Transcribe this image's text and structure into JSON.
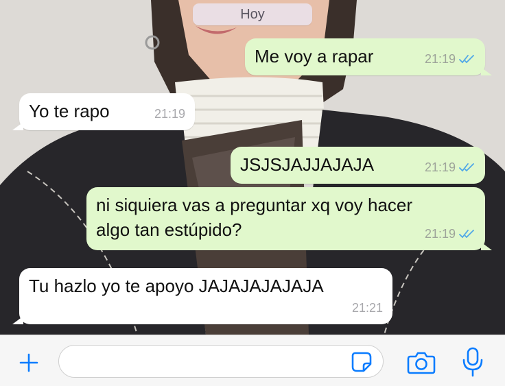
{
  "chat": {
    "day_separator": "Hoy",
    "messages": [
      {
        "direction": "outgoing",
        "text_lines": [
          "Me voy a rapar"
        ],
        "time": "21:19",
        "status": "read"
      },
      {
        "direction": "incoming",
        "text_lines": [
          "Yo te rapo"
        ],
        "time": "21:19"
      },
      {
        "direction": "outgoing",
        "text_lines": [
          "JSJSJAJJAJAJA"
        ],
        "time": "21:19",
        "status": "read"
      },
      {
        "direction": "outgoing",
        "text_lines": [
          "ni siquiera vas a preguntar xq voy hacer",
          "algo tan estúpido?"
        ],
        "time": "21:19",
        "status": "read"
      },
      {
        "direction": "incoming",
        "text_lines": [
          "Tu hazlo yo te apoyo JAJAJAJAJAJA"
        ],
        "time": "21:21"
      }
    ]
  },
  "composer": {
    "placeholder": "",
    "value": "",
    "icons": [
      "plus-icon",
      "sticker-icon",
      "camera-icon",
      "microphone-icon"
    ]
  },
  "colors": {
    "outgoing_bubble": "#e1f8cc",
    "incoming_bubble": "#ffffff",
    "read_ticks": "#4fa7e8",
    "accent": "#0a7cff"
  }
}
